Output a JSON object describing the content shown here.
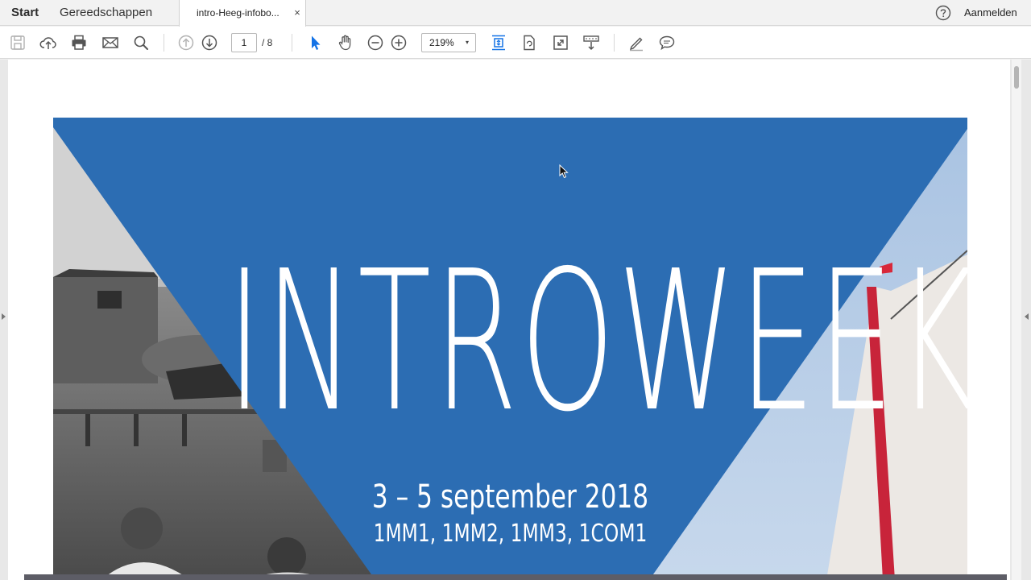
{
  "menu": {
    "start": "Start",
    "tools": "Gereedschappen"
  },
  "tab": {
    "title": "intro-Heeg-infobo...",
    "close": "×"
  },
  "account": {
    "signin": "Aanmelden"
  },
  "toolbar": {
    "page_current": "1",
    "page_total": "/ 8",
    "zoom": "219%",
    "zoom_caret": "▾"
  },
  "document": {
    "title": "INTROWEEK",
    "date": "3 – 5 september 2018",
    "classes": "1MM1, 1MM2, 1MM3, 1COM1"
  },
  "colors": {
    "accent_blue": "#2c6db3",
    "icon_blue": "#1473e6",
    "toolbar_icon": "#555555"
  }
}
